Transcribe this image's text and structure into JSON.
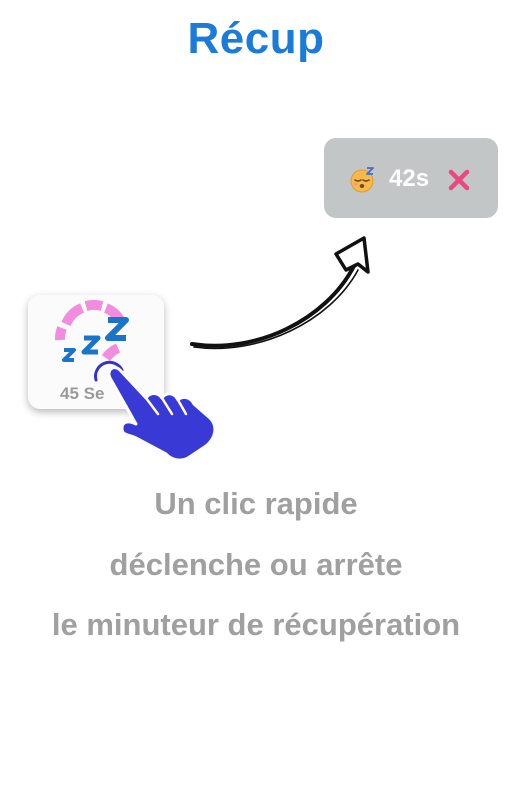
{
  "title": "Récup",
  "timer_pill": {
    "emoji_icon": "sleeping-face-icon",
    "time": "42s",
    "close_icon": "close-x-icon",
    "background_color": "#c3c6c7",
    "close_color": "#e84a7f"
  },
  "rest_button": {
    "icon": "zzz-sleep-icon",
    "label": "45 Se",
    "ring_color": "#f28cde",
    "z_color": "#1a74c9"
  },
  "hand_icon": "tap-hand-icon",
  "hand_color": "#3333cc",
  "arrow_icon": "curved-arrow-icon",
  "caption": {
    "line1": "Un clic rapide",
    "line2": "déclenche ou arrête",
    "line3": "le minuteur de récupération"
  },
  "colors": {
    "title": "#1a7bd8",
    "caption": "#a0a0a0"
  }
}
